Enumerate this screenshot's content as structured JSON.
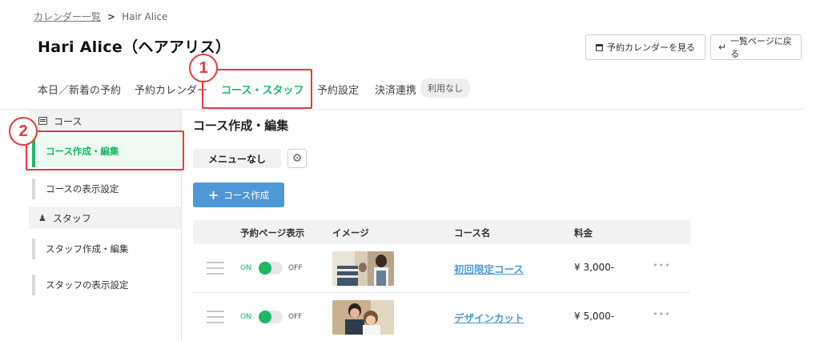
{
  "breadcrumb": {
    "parent": "カレンダー一覧",
    "separator": ">",
    "current": "Hair Alice"
  },
  "page_title": "Hari Alice（ヘアアリス）",
  "header_buttons": {
    "calendar": "予約カレンダーを見る",
    "back": "一覧ページに戻る"
  },
  "tabs": [
    {
      "label": "本日／新着の予約"
    },
    {
      "label": "予約カレンダー"
    },
    {
      "label": "コース・スタッフ"
    },
    {
      "label": "予約設定"
    },
    {
      "label": "決済連携"
    }
  ],
  "tab_badge": "利用なし",
  "callouts": {
    "one": "1",
    "two": "2"
  },
  "sidebar": {
    "course_section": "コース",
    "course_items": [
      "コース作成・編集",
      "コースの表示設定"
    ],
    "staff_section": "スタッフ",
    "staff_items": [
      "スタッフ作成・編集",
      "スタッフの表示設定"
    ]
  },
  "main": {
    "title": "コース作成・編集",
    "menu_label": "メニューなし",
    "add_button": "コース作成",
    "columns": [
      "予約ページ表示",
      "イメージ",
      "コース名",
      "料金"
    ],
    "toggle_on": "ON",
    "toggle_off": "OFF",
    "rows": [
      {
        "name": "初回限定コース",
        "price": "¥ 3,000-",
        "visible": true,
        "more": "•••"
      },
      {
        "name": "デザインカット",
        "price": "¥ 5,000-",
        "visible": true,
        "more": "•••"
      }
    ]
  },
  "colors": {
    "accent_green": "#1bb868",
    "link_blue": "#4f98d8",
    "callout_red": "#e8393f"
  }
}
